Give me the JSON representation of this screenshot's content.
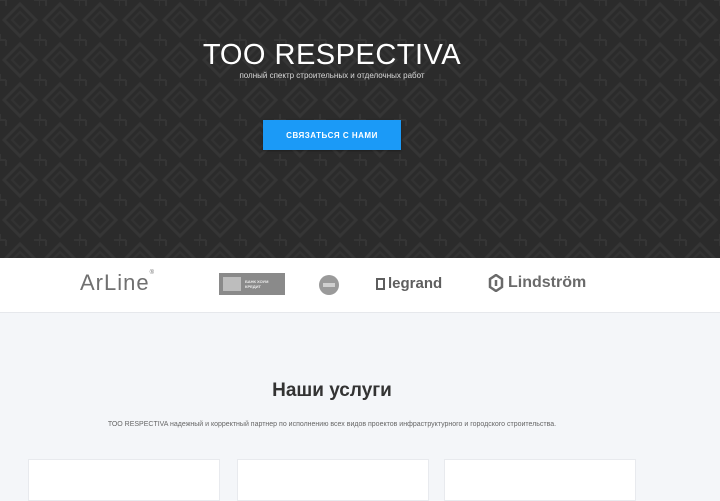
{
  "hero": {
    "title": "ТОО RESPECTIVA",
    "subtitle": "полный спектр строительных и отделочных работ",
    "cta_label": "СВЯЗАТЬСЯ С НАМИ"
  },
  "partners": {
    "arline": "ArLine",
    "arline_mark": "®",
    "bank_text": "БАНК ХОУМ КРЕДИТ",
    "legrand": "legrand",
    "lindstrom": "Lindström"
  },
  "services": {
    "title": "Наши услуги",
    "description": "ТОО RESPECTIVA надежный и корректный партнер по исполнению всех видов проектов инфраструктурного и городского строительства."
  },
  "colors": {
    "hero_bg": "#2b2b2b",
    "cta_bg": "#1b9af7",
    "page_bg": "#f4f6f9"
  }
}
